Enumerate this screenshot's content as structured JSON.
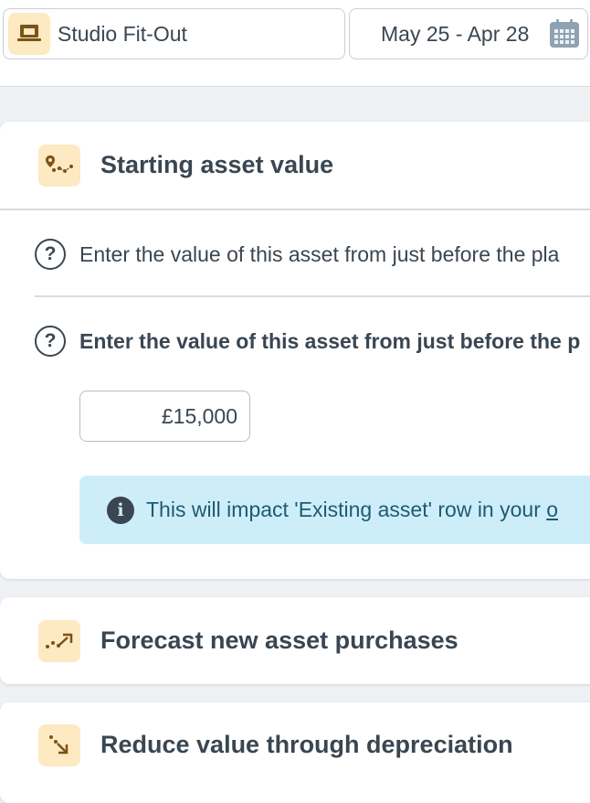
{
  "header": {
    "asset_name": "Studio Fit-Out",
    "asset_icon": "desk-icon",
    "date_range": "May 25 - Apr 28",
    "calendar_icon": "calendar-icon"
  },
  "sections": {
    "starting": {
      "title": "Starting asset value",
      "icon": "route-pin-icon",
      "question1": "Enter the value of this asset from just before the pla",
      "question2": "Enter the value of this asset from just before the p",
      "help_glyph": "?",
      "value": "£15,000",
      "info_glyph": "i",
      "info_text": "This will impact 'Existing asset' row in your ",
      "info_link": "o"
    },
    "purchases": {
      "title": "Forecast new asset purchases",
      "icon": "trend-up-icon"
    },
    "depreciation": {
      "title": "Reduce value through depreciation",
      "icon": "arrow-down-right-icon"
    }
  },
  "colors": {
    "accent_tint": "#fde9c2",
    "icon_brown": "#7a5316",
    "info_bg": "#cdeef9",
    "text": "#3a4651",
    "page_bg": "#eef2f5"
  }
}
